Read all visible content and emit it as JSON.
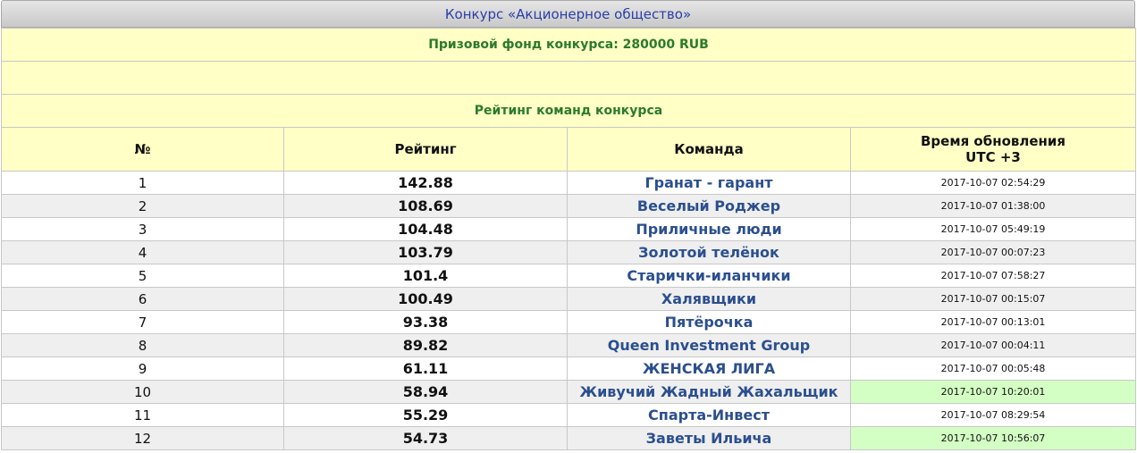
{
  "contest": {
    "title": "Конкурс «Акционерное общество»",
    "prize_fund": "Призовой фонд конкурса: 280000 RUB",
    "rating_heading": "Рейтинг команд конкурса"
  },
  "table": {
    "columns": [
      "№",
      "Рейтинг",
      "Команда",
      "Время обновления\nUTC +3"
    ],
    "rows": [
      {
        "num": "1",
        "rating": "142.88",
        "team": "Гранат - гарант",
        "time": "2017-10-07 02:54:29",
        "highlight": false
      },
      {
        "num": "2",
        "rating": "108.69",
        "team": "Веселый Роджер",
        "time": "2017-10-07 01:38:00",
        "highlight": false
      },
      {
        "num": "3",
        "rating": "104.48",
        "team": "Приличные люди",
        "time": "2017-10-07 05:49:19",
        "highlight": false
      },
      {
        "num": "4",
        "rating": "103.79",
        "team": "Золотой телёнок",
        "time": "2017-10-07 00:07:23",
        "highlight": false
      },
      {
        "num": "5",
        "rating": "101.4",
        "team": "Старички-иланчики",
        "time": "2017-10-07 07:58:27",
        "highlight": false
      },
      {
        "num": "6",
        "rating": "100.49",
        "team": "Халявщики",
        "time": "2017-10-07 00:15:07",
        "highlight": false
      },
      {
        "num": "7",
        "rating": "93.38",
        "team": "Пятёрочка",
        "time": "2017-10-07 00:13:01",
        "highlight": false
      },
      {
        "num": "8",
        "rating": "89.82",
        "team": "Queen Investment Group",
        "time": "2017-10-07 00:04:11",
        "highlight": false
      },
      {
        "num": "9",
        "rating": "61.11",
        "team": "ЖЕНСКАЯ ЛИГА",
        "time": "2017-10-07 00:05:48",
        "highlight": false
      },
      {
        "num": "10",
        "rating": "58.94",
        "team": "Живучий Жадный Жахальщик",
        "time": "2017-10-07 10:20:01",
        "highlight": true
      },
      {
        "num": "11",
        "rating": "55.29",
        "team": "Спарта-Инвест",
        "time": "2017-10-07 08:29:54",
        "highlight": false
      },
      {
        "num": "12",
        "rating": "54.73",
        "team": "Заветы Ильича",
        "time": "2017-10-07 10:56:07",
        "highlight": true
      }
    ]
  },
  "colors": {
    "header_bg": "#ffffc6",
    "heading_text": "#2c7a2c",
    "title_text": "#2a3fa8",
    "team_link": "#2b4f8f",
    "fresh_update": "#d4ffc4",
    "alt_row": "#efefef"
  }
}
